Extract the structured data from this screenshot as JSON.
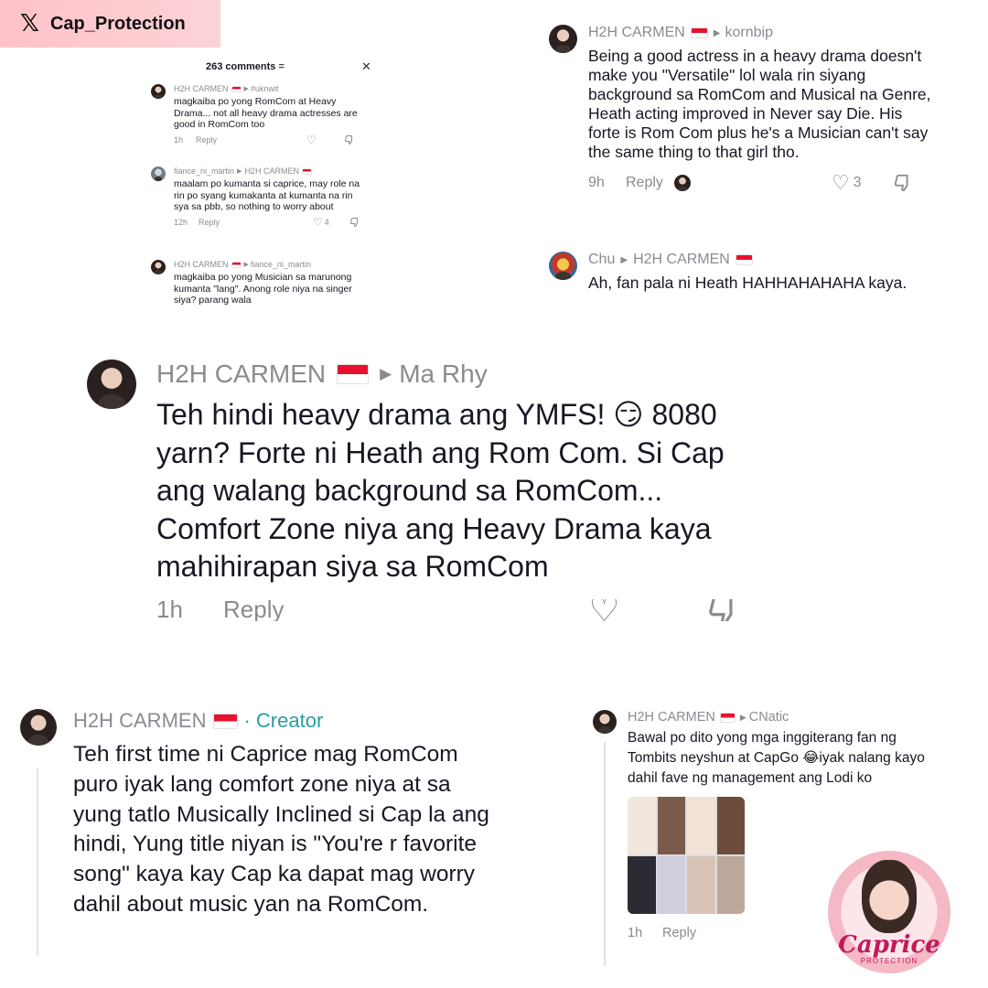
{
  "header": {
    "x_logo": "𝕏",
    "account": "Cap_Protection"
  },
  "panel1": {
    "sheet_title": "263 comments",
    "comments": [
      {
        "user": "H2H CARMEN",
        "reply_to": "#uknwit",
        "text": "magkaiba po yong RomCom at Heavy Drama... not all heavy drama actresses are good in RomCom too",
        "time": "1h",
        "reply": "Reply"
      },
      {
        "user": "fiance_ni_martin",
        "reply_to": "H2H CARMEN",
        "text": "maalam po kumanta si caprice, may role na rin po syang kumakanta at kumanta na rin sya sa pbb, so nothing to worry about",
        "time": "12h",
        "reply": "Reply",
        "likes": "4"
      },
      {
        "user": "H2H CARMEN",
        "reply_to": "fiance_ni_martin",
        "text": "magkaiba po yong Musician sa marunong kumanta \"lang\". Anong role niya na singer siya? parang wala"
      }
    ]
  },
  "panel2": {
    "comments": [
      {
        "user": "H2H CARMEN",
        "reply_to": "kornbip",
        "text": "Being a good actress in a heavy drama doesn't make you \"Versatile\" lol wala rin siyang background sa RomCom and Musical na Genre, Heath acting improved in Never say Die. His forte is Rom Com plus he's a Musician can't say the same thing to that girl tho.",
        "time": "9h",
        "reply": "Reply",
        "likes": "3"
      },
      {
        "user": "Chu",
        "reply_to": "H2H CARMEN",
        "text": "Ah, fan pala ni Heath HAHHAHAHAHA kaya."
      }
    ]
  },
  "panel3": {
    "user": "H2H CARMEN",
    "reply_to": "Ma Rhy",
    "text": "Teh hindi heavy drama ang YMFS! 😏 8080 yarn? Forte ni Heath ang Rom Com. Si Cap ang walang background sa RomCom... Comfort Zone niya ang Heavy Drama kaya mahihirapan siya sa RomCom",
    "time": "1h",
    "reply": "Reply"
  },
  "panel4": {
    "user": "H2H CARMEN",
    "badge": "Creator",
    "text": "Teh first time ni Caprice mag RomCom puro iyak lang comfort zone niya at sa yung tatlo Musically Inclined si Cap la ang hindi, Yung title niyan is \"You're r favorite song\" kaya kay Cap ka dapat mag worry dahil about music yan na RomCom."
  },
  "panel5": {
    "user": "H2H CARMEN",
    "reply_to": "CNatic",
    "text": "Bawal po dito yong mga inggiterang fan ng Tombits neyshun at CapGo 😂iyak nalang kayo dahil fave ng management ang Lodi ko",
    "time": "1h",
    "reply": "Reply"
  },
  "logo": {
    "script": "Caprice",
    "sub": "PROTECTION"
  },
  "colors": {
    "badge": "#ffc2c8",
    "creator": "#2a9d9f",
    "flag_red": "#e8112d",
    "muted": "#8a8b91",
    "text": "#161823"
  },
  "icons": [
    "x-logo-icon",
    "close-icon",
    "heart-icon",
    "dislike-icon",
    "chevron-right-icon",
    "flag-icon"
  ]
}
